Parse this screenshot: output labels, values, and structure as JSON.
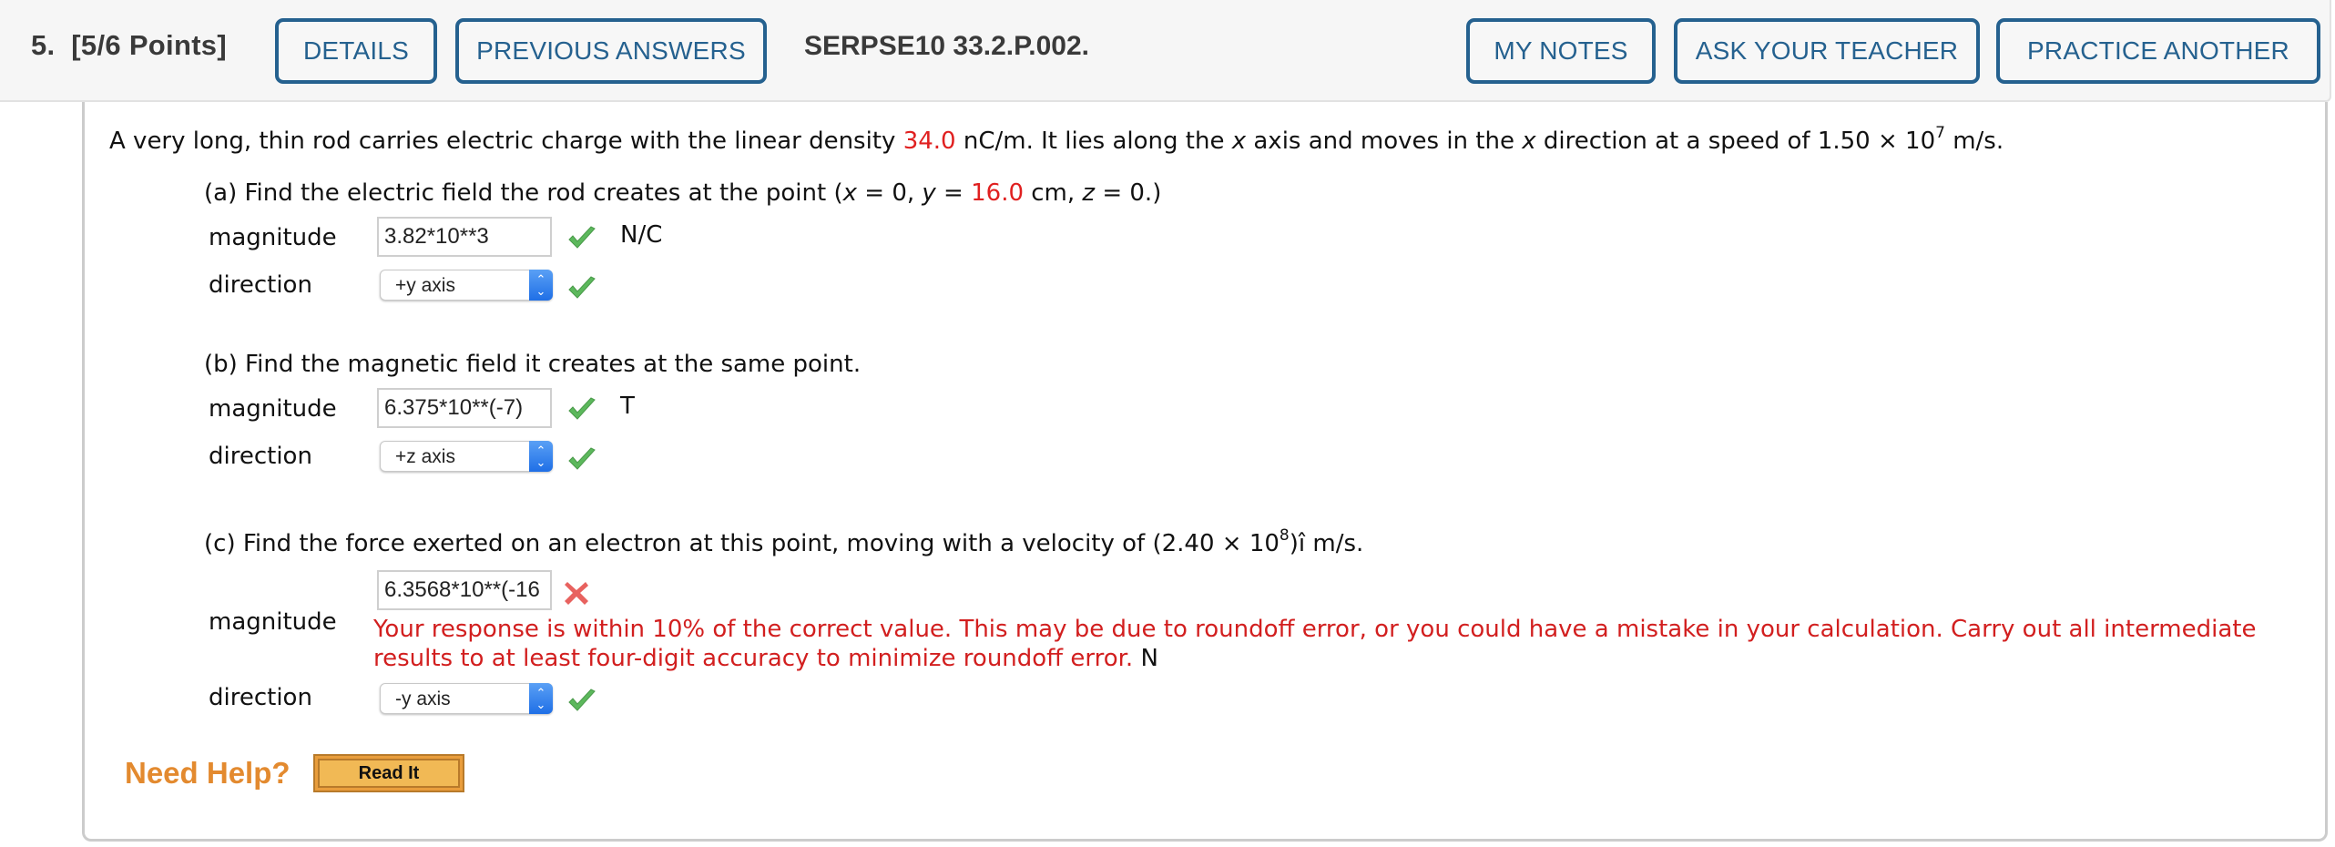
{
  "header": {
    "question_number": "5.",
    "points": "[5/6 Points]",
    "details_label": "DETAILS",
    "previous_answers_label": "PREVIOUS ANSWERS",
    "problem_code": "SERPSE10 33.2.P.002.",
    "my_notes_label": "MY NOTES",
    "ask_teacher_label": "ASK YOUR TEACHER",
    "practice_another_label": "PRACTICE ANOTHER"
  },
  "problem": {
    "intro_1": "A very long, thin rod carries electric charge with the linear density ",
    "density_value": "34.0",
    "intro_2": " nC/m. It lies along the ",
    "var_x1": "x",
    "intro_3": " axis and moves in the ",
    "var_x2": "x",
    "intro_4": " direction at a speed of 1.50 × 10",
    "speed_exp": "7",
    "intro_5": " m/s."
  },
  "part_a": {
    "prompt_1": "(a) Find the electric field the rod creates at the point (",
    "x_eq": "x",
    "prompt_2": " = 0, ",
    "y_eq": "y",
    "prompt_3": " = ",
    "y_value": "16.0",
    "prompt_4": " cm, ",
    "z_eq": "z",
    "prompt_5": " = 0.)",
    "magnitude_label": "magnitude",
    "magnitude_value": "3.82*10**3",
    "magnitude_status": "correct",
    "magnitude_unit": "N/C",
    "direction_label": "direction",
    "direction_value": "+y axis",
    "direction_status": "correct"
  },
  "part_b": {
    "prompt": "(b) Find the magnetic field it creates at the same point.",
    "magnitude_label": "magnitude",
    "magnitude_value": "6.375*10**(-7)",
    "magnitude_status": "correct",
    "magnitude_unit": "T",
    "direction_label": "direction",
    "direction_value": "+z axis",
    "direction_status": "correct"
  },
  "part_c": {
    "prompt_1": "(c) Find the force exerted on an electron at this point, moving with a velocity of (2.40 × 10",
    "velocity_exp": "8",
    "prompt_2": ")î m/s.",
    "magnitude_label": "magnitude",
    "magnitude_value": "6.3568*10**(-16",
    "magnitude_status": "incorrect",
    "feedback_line1": "Your response is within 10% of the correct value. This may be due to roundoff error, or you could have a mistake in your calculation. Carry out all intermediate",
    "feedback_line2": "results to at least four-digit accuracy to minimize roundoff error.",
    "magnitude_unit": "N",
    "direction_label": "direction",
    "direction_value": "-y axis",
    "direction_status": "correct"
  },
  "help": {
    "need_help_label": "Need Help?",
    "read_it_label": "Read It"
  },
  "colors": {
    "accent_blue": "#25618f",
    "given_value_red": "#e02020",
    "feedback_red": "#d21f1f",
    "correct_green": "#5cb85c",
    "incorrect_red": "#e8625f",
    "help_orange": "#e38a2f"
  }
}
